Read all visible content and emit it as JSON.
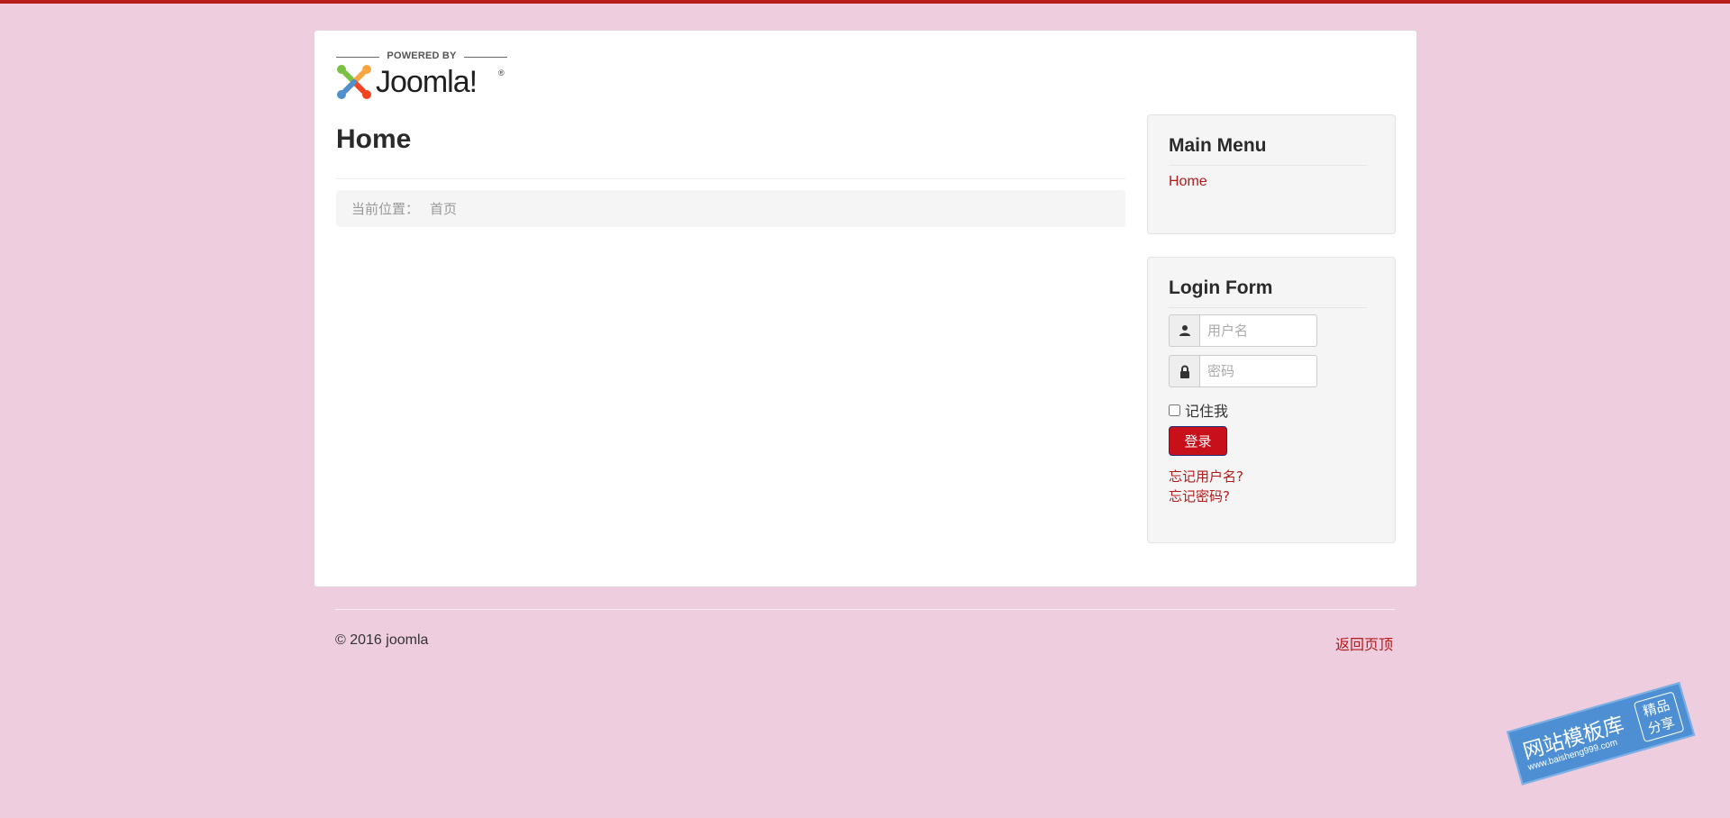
{
  "header": {
    "powered_by": "POWERED BY",
    "brand_name": "Joomla!",
    "brand_registered": "®",
    "brand_colors": [
      "#7ac143",
      "#f9a541",
      "#f44321",
      "#5091cd"
    ],
    "accent_color": "#b81c1c"
  },
  "main": {
    "title": "Home",
    "breadcrumb": {
      "label": "当前位置：",
      "current": "首页"
    }
  },
  "sidebar": {
    "main_menu": {
      "title": "Main Menu",
      "items": [
        {
          "label": "Home"
        }
      ]
    },
    "login_form": {
      "title": "Login Form",
      "username_placeholder": "用户名",
      "username_value": "",
      "password_placeholder": "密码",
      "password_value": "",
      "remember_label": "记住我",
      "remember_checked": false,
      "login_button": "登录",
      "forgot_username": "忘记用户名?",
      "forgot_password": "忘记密码?",
      "user_icon": "user-icon",
      "lock_icon": "lock-icon"
    }
  },
  "footer": {
    "copyright": "© 2016 joomla",
    "back_to_top": "返回页顶"
  },
  "watermark": {
    "main": "网站模板库",
    "sub": "www.baisheng999.com",
    "badge_line1": "精品",
    "badge_line2": "分享"
  }
}
